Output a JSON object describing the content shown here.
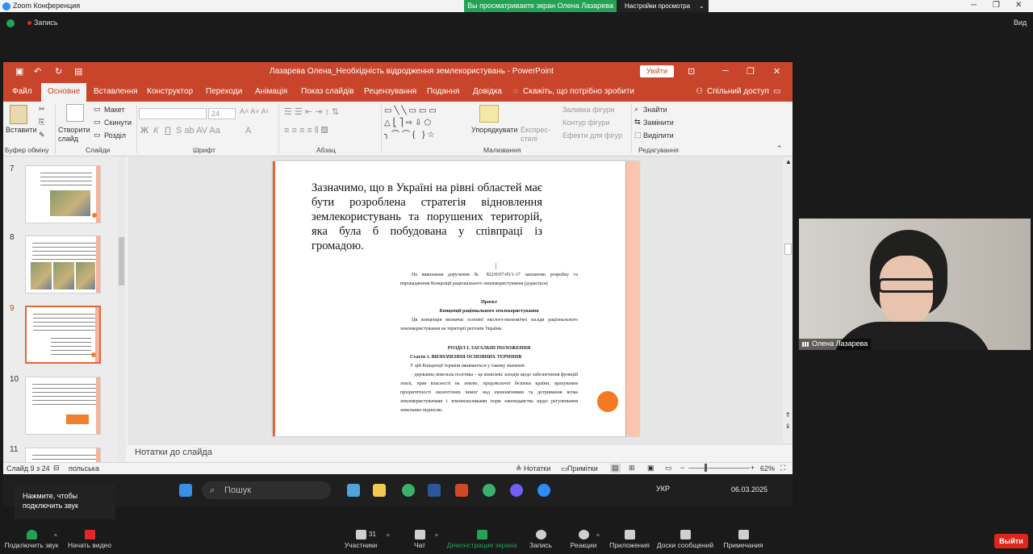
{
  "zoom": {
    "window_title": "Zoom Конференция",
    "share_banner": "Вы просматриваете экран Олена Лазарева",
    "view_settings": "Настройки просмотра",
    "recording": "Запись",
    "view": "Вид",
    "tooltip": "Нажмите, чтобы подключить звук",
    "participants_count": "31",
    "toolbar": [
      {
        "name": "audio",
        "label": "Подключить звук"
      },
      {
        "name": "video",
        "label": "Начать видео"
      },
      {
        "name": "participants",
        "label": "Участники"
      },
      {
        "name": "chat",
        "label": "Чат"
      },
      {
        "name": "share",
        "label": "Демонстрация экрана"
      },
      {
        "name": "record",
        "label": "Запись"
      },
      {
        "name": "reactions",
        "label": "Реакции"
      },
      {
        "name": "apps",
        "label": "Приложения"
      },
      {
        "name": "whiteboards",
        "label": "Доски сообщений"
      },
      {
        "name": "notes",
        "label": "Примечания"
      }
    ],
    "leave": "Выйти",
    "video_name": "Олена Лазарева"
  },
  "ppt": {
    "title": "Лазарева Олена_Необхідність відродження землекористувань  -  PowerPoint",
    "signin": "Увійти",
    "tabs": [
      "Файл",
      "Основне",
      "Вставлення",
      "Конструктор",
      "Переходи",
      "Анімація",
      "Показ слайдів",
      "Рецензування",
      "Подання",
      "Довідка"
    ],
    "tell_me": "Скажіть, що потрібно зробити",
    "share": "Спільний доступ",
    "ribbon": {
      "paste": "Вставити",
      "clipboard": "Буфер обміну",
      "new_slide": "Створити слайд",
      "layout": "Макет",
      "reset": "Скинути",
      "section": "Розділ",
      "slides": "Слайди",
      "font_size": "24",
      "font": "Шрифт",
      "paragraph": "Абзац",
      "arrange": "Упорядкувати",
      "quick_styles": "Експрес-стилі",
      "shape_fill": "Заливка фігури",
      "shape_outline": "Контур фігури",
      "shape_effects": "Ефекти для фігур",
      "drawing": "Малювання",
      "find": "Знайти",
      "replace": "Замінити",
      "select": "Виділити",
      "editing": "Редагування"
    },
    "thumbnails": [
      "7",
      "8",
      "9",
      "10",
      "11"
    ],
    "selected_slide": "9",
    "slide": {
      "heading": "Зазначимо, що в Україні на рівні областей має бути розроблена стратегія відновлення землекористувань та порушених територій, яка була б побудована у співпраці із громадою.",
      "doc_p1": "На виконання доручення № 822/0/07-05/1-17 запланово розробку та впровадження Концепції раціонального землекористування (додається)",
      "doc_project": "Проект",
      "doc_concept": "Концепції раціонального землекористування",
      "doc_p2": "Ця концепція визначає основні еколого-економічні засади раціонального землекористування на території регіонів України.",
      "doc_section": "РОЗДІЛ І. ЗАГАЛЬНІ ПОЛОЖЕННЯ",
      "doc_article": "Стаття 1. ВИЗНАЧЕННЯ ОСНОВНИХ ТЕРМІНІВ",
      "doc_p3": "У цій Концепції терміни вживаються у такому значенні:",
      "doc_p4": "- державна земельна політика – це комплекс заходів щодо забезпечення функцій землі, прав власності на землю, продовольчої безпеки країни, врахування пріоритетності екологічних вимог над економічними та дотримання всіма землекористувачами і землевласниками норм законодавства щодо регулювання земельних відносин."
    },
    "notes_placeholder": "Нотатки до слайда",
    "status": {
      "slide_of": "Слайд 9 з 24",
      "language": "польська",
      "notes": "Нотатки",
      "comments": "Примітки",
      "zoom": "62%"
    }
  },
  "taskbar": {
    "search": "Пошук",
    "lang": "УКР",
    "date": "06.03.2025"
  },
  "colors": {
    "ppt_accent": "#c8452b",
    "zoom_green": "#23a254",
    "zoom_leave": "#e0251b"
  }
}
